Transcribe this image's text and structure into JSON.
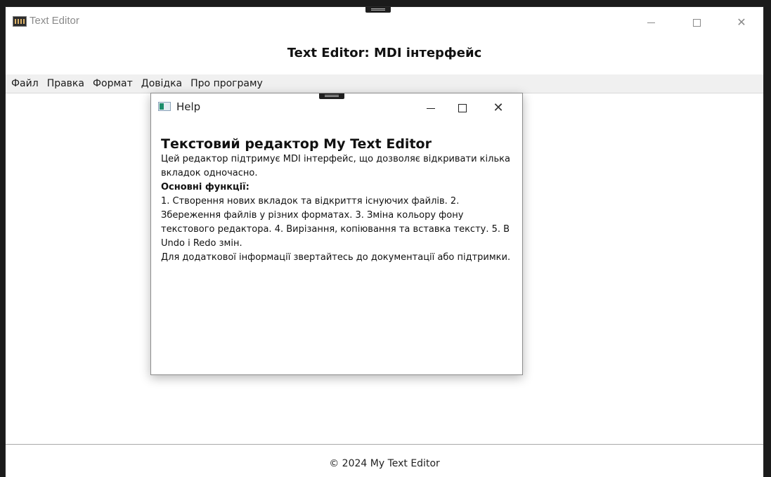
{
  "window": {
    "title": "Text Editor",
    "controls": {
      "minimize": "minimize",
      "maximize": "maximize",
      "close": "✕"
    }
  },
  "header": {
    "title": "Text Editor: MDI інтерфейс"
  },
  "menu": {
    "items": [
      "Файл",
      "Правка",
      "Формат",
      "Довідка",
      "Про програму"
    ]
  },
  "help_window": {
    "title": "Help",
    "close": "✕",
    "heading": "Текстовий редактор My Text Editor",
    "intro": "Цей редактор підтримує MDI інтерфейс, що дозволяє відкривати кілька вкладок одночасно.",
    "features_heading": "Основні функції:",
    "features_text": "1. Створення нових вкладок та відкриття існуючих файлів. 2. Збереження файлів у різних форматах. 3. Зміна кольору фону текстового редактора. 4. Вирізання, копіювання та вставка тексту. 5. В Undo і Redo змін.",
    "support_text": "Для додаткової інформації звертайтесь до документації або підтримки."
  },
  "footer": {
    "text": "© 2024 My Text Editor"
  },
  "colors": {
    "menu_background": "#f0f0f0",
    "window_background": "#ffffff",
    "desktop_background": "#1b1b1b"
  },
  "icons": {
    "app": "app-icon",
    "help": "help-window-icon",
    "drag": "drag-handle-icon"
  }
}
